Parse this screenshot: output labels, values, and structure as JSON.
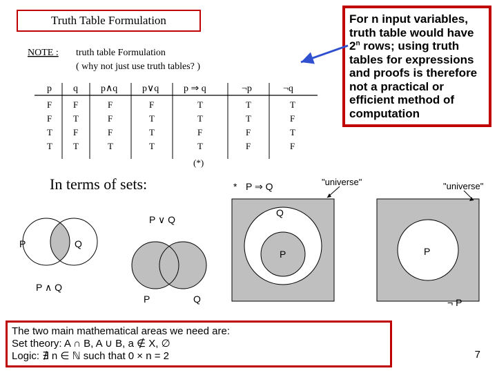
{
  "title": "Truth Table Formulation",
  "note": {
    "pre": "For n input variables, truth table would have 2",
    "exp": "n",
    "post": " rows; using truth tables for expressions and proofs is therefore not a practical or efficient method of computation"
  },
  "handwritten": {
    "noteLabel": "NOTE :",
    "line1": "truth table Formulation",
    "line2": "( why not just use truth tables? )",
    "headers": [
      "p",
      "q",
      "p∧q",
      "p∨q",
      "p ⇒ q",
      "¬p",
      "¬q"
    ],
    "rows": [
      [
        "F",
        "F",
        "F",
        "F",
        "T",
        "T",
        "T"
      ],
      [
        "F",
        "T",
        "F",
        "T",
        "T",
        "T",
        "F"
      ],
      [
        "T",
        "F",
        "F",
        "T",
        "F",
        "F",
        "T"
      ],
      [
        "T",
        "T",
        "T",
        "T",
        "T",
        "F",
        "F"
      ]
    ],
    "star": "(*)"
  },
  "setsHeading": "In terms of sets:",
  "diagrams": {
    "intersect": {
      "p": "P",
      "q": "Q",
      "expr": "P ∧ Q"
    },
    "union": {
      "p": "P",
      "q": "Q",
      "expr": "P ∨ Q"
    },
    "implies": {
      "star": "*",
      "expr": "P ⇒ Q",
      "p": "P",
      "q": "Q",
      "universe": "\"universe\""
    },
    "neg": {
      "p": "P",
      "expr": "¬ P",
      "universe": "\"universe\""
    }
  },
  "footer": {
    "l1": "The two main mathematical areas we need are:",
    "l2": "Set theory: A ∩ B, A ∪ B, a ∉ X, ∅",
    "l3": "Logic: ∄ n ∈ ℕ such that 0 × n = 2"
  },
  "pageNumber": "7"
}
